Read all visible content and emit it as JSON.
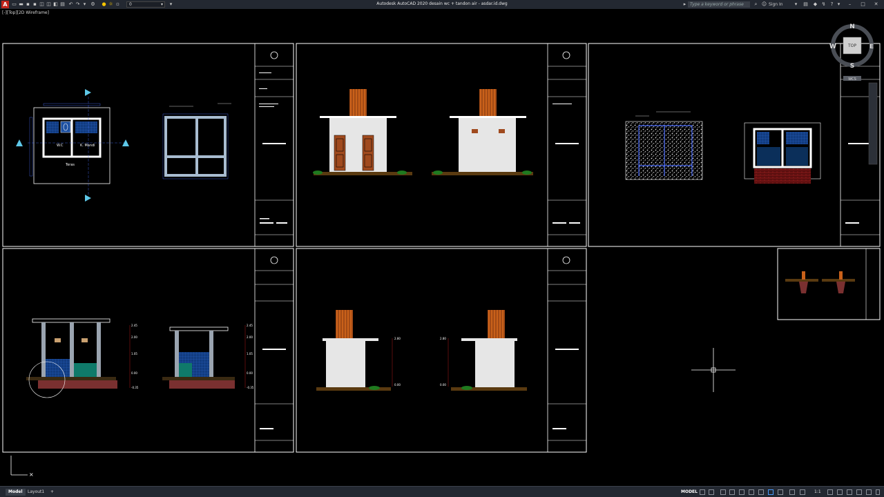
{
  "titlebar": {
    "logo_letter": "A",
    "app_title": "Autodesk AutoCAD 2020    desain wc + tandon air - asdar.id.dwg",
    "workspace_value": "0",
    "search_placeholder": "Type a keyword or phrase",
    "sign_in_label": "Sign In"
  },
  "viewport": {
    "label": "[-][Top][2D Wireframe]"
  },
  "viewcube": {
    "north": "N",
    "west": "W",
    "east": "E",
    "south": "S",
    "face": "TOP",
    "wcs": "WCS"
  },
  "plan_labels": {
    "wc": "W.C",
    "kamar_mandi": "K. Mandi",
    "teras": "Teras"
  },
  "section_levels": {
    "left": [
      "2.45",
      "2.00",
      "1.05",
      "0.00",
      "-0.35"
    ],
    "right": [
      "2.45",
      "2.00",
      "1.05",
      "0.00",
      "-0.35"
    ]
  },
  "elevation_levels": {
    "left": [
      "2.80",
      "0.00"
    ],
    "right": [
      "2.80",
      "0.00"
    ]
  },
  "statusbar": {
    "tabs": [
      "Model",
      "Layout1"
    ],
    "add_tab": "+",
    "model_label": "MODEL",
    "scale": "1:1"
  },
  "colors": {
    "titlebar_bg": "#232831",
    "canvas_bg": "#000000",
    "frame": "#ffffff",
    "wall": "#e6e6e6",
    "door": "#a04a1e",
    "tank": "#d2691e",
    "tile_blue": "#1c4fa0",
    "ground_green": "#1f7a1f",
    "dimension_red": "#e02020",
    "dimension_blue": "#4a6cff",
    "teal": "#0f7a6a"
  }
}
